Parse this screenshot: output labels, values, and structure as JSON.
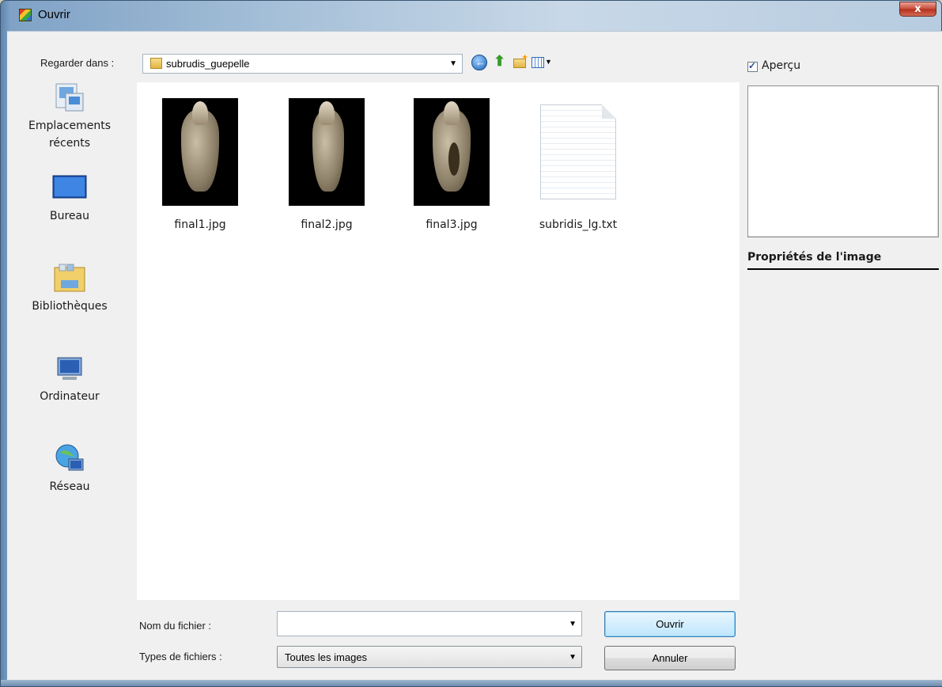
{
  "window": {
    "title": "Ouvrir",
    "close_label": "x"
  },
  "lookin": {
    "label": "Regarder dans :",
    "value": "subrudis_guepelle"
  },
  "places": [
    {
      "label": "Emplacements récents",
      "icon": "recent-places-icon"
    },
    {
      "label": "Bureau",
      "icon": "desktop-icon"
    },
    {
      "label": "Bibliothèques",
      "icon": "libraries-icon"
    },
    {
      "label": "Ordinateur",
      "icon": "computer-icon"
    },
    {
      "label": "Réseau",
      "icon": "network-icon"
    }
  ],
  "files": [
    {
      "name": "final1.jpg",
      "type": "image"
    },
    {
      "name": "final2.jpg",
      "type": "image"
    },
    {
      "name": "final3.jpg",
      "type": "image"
    },
    {
      "name": "subridis_lg.txt",
      "type": "text"
    }
  ],
  "preview": {
    "checkbox_label": "Aperçu",
    "checked": true,
    "props_title": "Propriétés de l'image"
  },
  "filename": {
    "label": "Nom du fichier :",
    "value": ""
  },
  "filetypes": {
    "label": "Types de fichiers :",
    "value": "Toutes les images"
  },
  "buttons": {
    "open": "Ouvrir",
    "cancel": "Annuler"
  },
  "colors": {
    "frame": "#a6c0d8",
    "client_bg": "#f0f0f0",
    "open_button": "#bee6fd",
    "close_button": "#c74a37"
  }
}
